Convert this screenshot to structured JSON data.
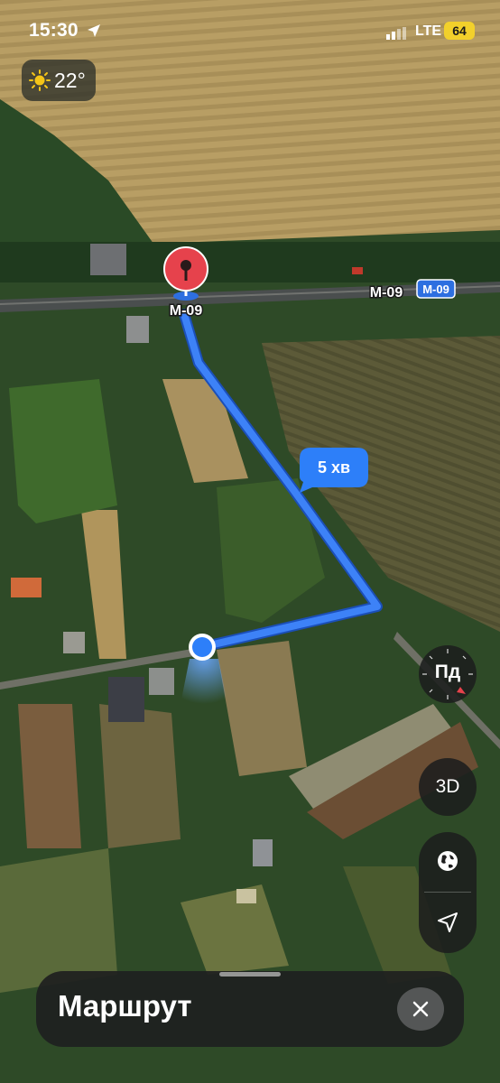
{
  "status_bar": {
    "time": "15:30",
    "network": "LTE",
    "battery": "64"
  },
  "weather": {
    "temperature": "22°",
    "icon": "sun-icon"
  },
  "map": {
    "road_label_pin": "М-09",
    "road_label_right": "М-09",
    "road_shield": "М-09",
    "route_eta": "5 хв",
    "colors": {
      "route": "#3d82f7",
      "pin": "#e6424c",
      "user_dot": "#2d7ff9"
    }
  },
  "controls": {
    "compass_label": "Пд",
    "view_3d_label": "3D",
    "map_mode_icon": "globe-icon",
    "locate_icon": "location-arrow-icon"
  },
  "sheet": {
    "title": "Маршрут",
    "close_icon": "close-icon"
  }
}
